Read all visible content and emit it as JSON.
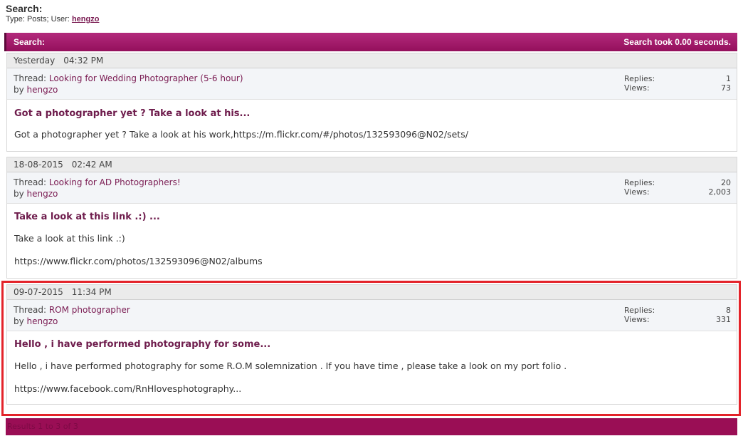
{
  "header": {
    "title": "Search:",
    "filter_prefix": "Type: Posts; User:",
    "user": "hengzo"
  },
  "search_bar": {
    "label": "Search:",
    "timing": "Search took 0.00 seconds."
  },
  "labels": {
    "thread_prefix": "Thread:",
    "by_prefix": "by",
    "replies": "Replies:",
    "views": "Views:"
  },
  "results": [
    {
      "date": "Yesterday",
      "time": "04:32 PM",
      "thread_title": "Looking for Wedding Photographer (5-6 hour)",
      "author": "hengzo",
      "replies": "1",
      "views": "73",
      "post_title": "Got a photographer yet ? Take a look at his...",
      "lines": [
        "Got a photographer yet ? Take a look at his work,https://m.flickr.com/#/photos/132593096@N02/sets/"
      ]
    },
    {
      "date": "18-08-2015",
      "time": "02:42 AM",
      "thread_title": "Looking for AD Photographers!",
      "author": "hengzo",
      "replies": "20",
      "views": "2,003",
      "post_title": "Take a look at this link .:) ...",
      "lines": [
        "Take a look at this link .:)",
        "https://www.flickr.com/photos/132593096@N02/albums"
      ]
    },
    {
      "date": "09-07-2015",
      "time": "11:34 PM",
      "thread_title": "ROM photographer",
      "author": "hengzo",
      "replies": "8",
      "views": "331",
      "post_title": "Hello , i have performed photography for some...",
      "lines": [
        "Hello , i have performed photography for some R.O.M solemnization . If you have time , please take a look on my port folio .",
        "https://www.facebook.com/RnHlovesphotography..."
      ]
    }
  ],
  "footer": {
    "text": "Results 1 to 3 of 3"
  }
}
